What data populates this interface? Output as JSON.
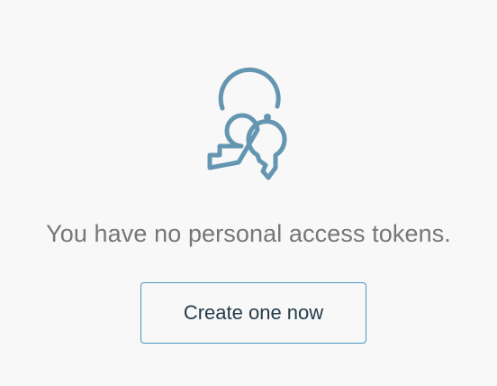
{
  "empty_state": {
    "icon": "keys-icon",
    "message": "You have no personal access tokens.",
    "create_button_label": "Create one now"
  },
  "colors": {
    "icon": "#6596b1",
    "message_text": "#767676",
    "button_border": "#4b97bf",
    "button_text": "#243b4a",
    "background": "#f8f8f8"
  }
}
